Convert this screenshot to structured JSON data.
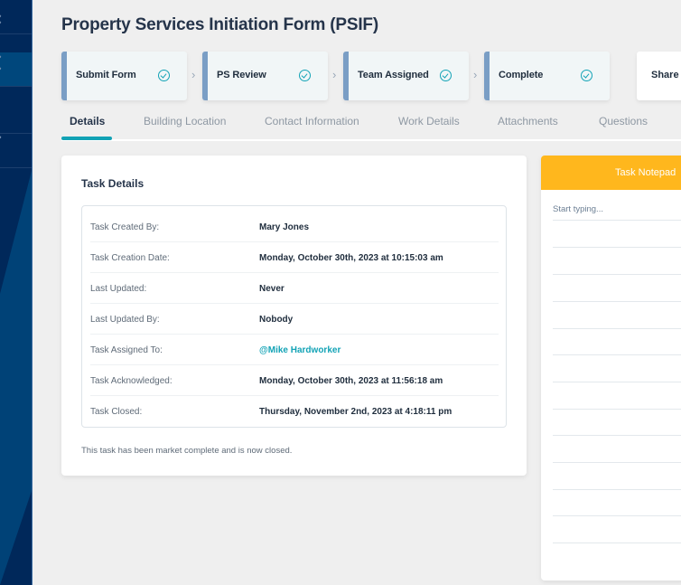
{
  "sidebar": {
    "colors": {
      "base": "#00285a",
      "active": "#00477c"
    },
    "items": [
      {
        "name": "nav-item-1",
        "active": false
      },
      {
        "name": "nav-item-2",
        "active": true
      },
      {
        "name": "nav-item-3",
        "active": false
      },
      {
        "name": "nav-item-4",
        "active": false
      }
    ],
    "chevron_glyph": "›"
  },
  "header": {
    "title": "Property Services Initiation Form (PSIF)"
  },
  "stepper": {
    "steps": [
      {
        "label": "Submit Form",
        "status": "complete",
        "icon": "check-circle-icon"
      },
      {
        "label": "PS Review",
        "status": "complete",
        "icon": "check-circle-icon"
      },
      {
        "label": "Team Assigned",
        "status": "complete",
        "icon": "check-circle-icon"
      },
      {
        "label": "Complete",
        "status": "complete",
        "icon": "check-circle-icon"
      }
    ],
    "separator_glyph": "›",
    "share_label": "Share",
    "colors": {
      "accent_bar": "#7a9ec5",
      "check": "#13a3b6"
    }
  },
  "tabs": {
    "items": [
      {
        "label": "Details",
        "active": true
      },
      {
        "label": "Building Location",
        "active": false
      },
      {
        "label": "Contact Information",
        "active": false
      },
      {
        "label": "Work Details",
        "active": false
      },
      {
        "label": "Attachments",
        "active": false
      },
      {
        "label": "Questions",
        "active": false
      }
    ],
    "accent": "#12a2b5"
  },
  "task_details": {
    "title": "Task Details",
    "rows": [
      {
        "label": "Task Created By:",
        "value": "Mary Jones"
      },
      {
        "label": "Task Creation Date:",
        "value": "Monday, October 30th, 2023 at 10:15:03 am"
      },
      {
        "label": "Last Updated:",
        "value": "Never"
      },
      {
        "label": "Last Updated By:",
        "value": "Nobody"
      },
      {
        "label": "Task Assigned To:",
        "value": "@Mike Hardworker",
        "link": true
      },
      {
        "label": "Task Acknowledged:",
        "value": "Monday, October 30th, 2023 at 11:56:18 am"
      },
      {
        "label": "Task Closed:",
        "value": "Thursday, November 2nd, 2023 at 4:18:11 pm"
      }
    ],
    "note": "This task has been market complete and is now closed."
  },
  "notepad": {
    "title": "Task Notepad",
    "placeholder": "Start typing...",
    "header_color": "#ffb71d"
  }
}
